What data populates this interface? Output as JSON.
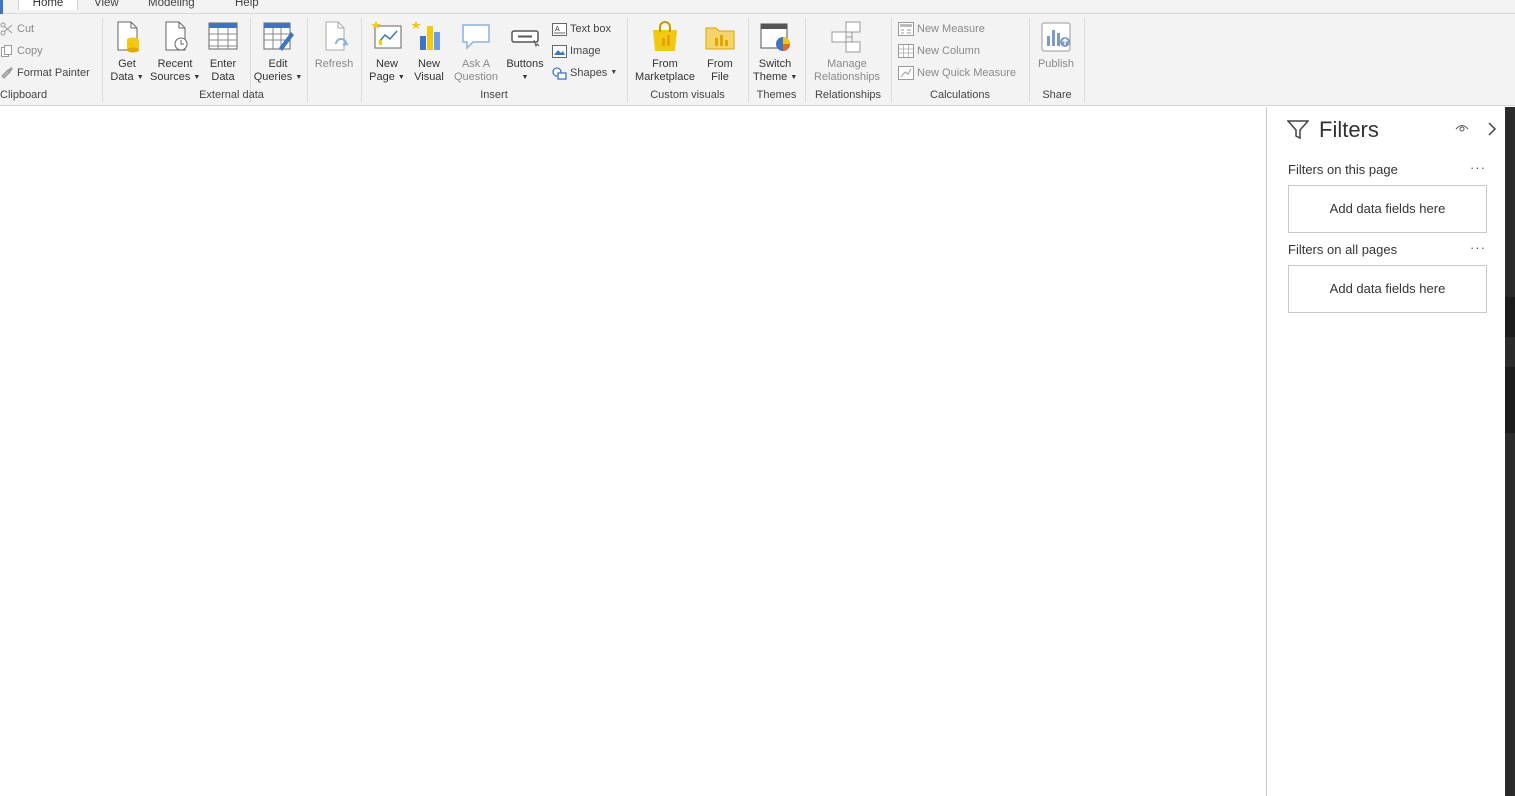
{
  "tabs": [
    {
      "label": "Home",
      "active": true
    },
    {
      "label": "View",
      "active": false
    },
    {
      "label": "Modeling",
      "active": false
    },
    {
      "label": "Help",
      "active": false
    }
  ],
  "ribbon": {
    "clipboard": {
      "label": "Clipboard",
      "cut": "Cut",
      "copy": "Copy",
      "format_painter": "Format Painter"
    },
    "external_data": {
      "label": "External data",
      "get_data": [
        "Get",
        "Data"
      ],
      "recent_sources": [
        "Recent",
        "Sources"
      ],
      "enter_data": [
        "Enter",
        "Data"
      ],
      "edit_queries": [
        "Edit",
        "Queries"
      ],
      "refresh": "Refresh"
    },
    "insert": {
      "label": "Insert",
      "new_page": [
        "New",
        "Page"
      ],
      "new_visual": [
        "New",
        "Visual"
      ],
      "ask_question": [
        "Ask A",
        "Question"
      ],
      "buttons": "Buttons",
      "text_box": "Text box",
      "image": "Image",
      "shapes": "Shapes"
    },
    "custom_visuals": {
      "label": "Custom visuals",
      "from_marketplace": [
        "From",
        "Marketplace"
      ],
      "from_file": [
        "From",
        "File"
      ]
    },
    "themes": {
      "label": "Themes",
      "switch_theme": [
        "Switch",
        "Theme"
      ]
    },
    "relationships": {
      "label": "Relationships",
      "manage": [
        "Manage",
        "Relationships"
      ]
    },
    "calculations": {
      "label": "Calculations",
      "new_measure": "New Measure",
      "new_column": "New Column",
      "new_quick_measure": "New Quick Measure"
    },
    "share": {
      "label": "Share",
      "publish": "Publish"
    }
  },
  "filters": {
    "title": "Filters",
    "on_this_page": "Filters on this page",
    "on_all_pages": "Filters on all pages",
    "well_placeholder": "Add data fields here",
    "more": "···"
  },
  "colors": {
    "accent": "#3f74c4",
    "ribbon_bg": "#f3f3f3",
    "icon_yellow": "#f2c811"
  }
}
